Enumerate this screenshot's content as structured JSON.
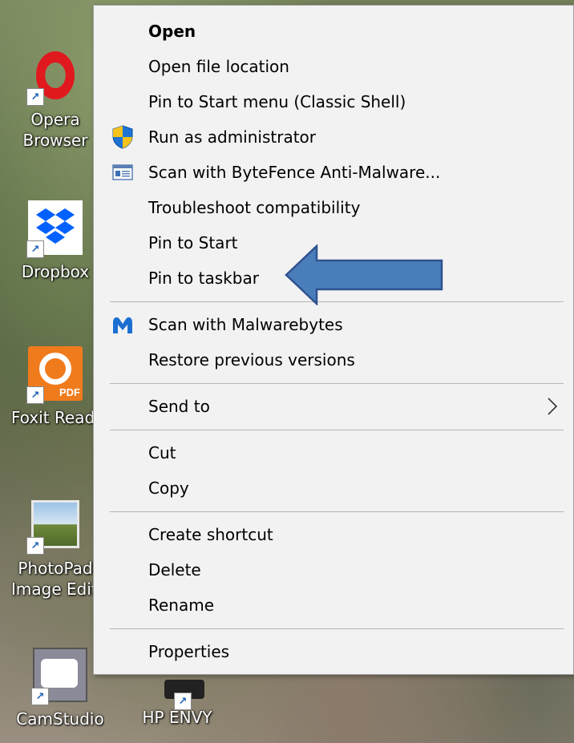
{
  "desktop": {
    "icons": [
      {
        "label_1": "Opera",
        "label_2": "Browser"
      },
      {
        "label_1": "Dropbox"
      },
      {
        "label_1": "Foxit Reader",
        "badge": "PDF"
      },
      {
        "label_1": "PhotoPad",
        "label_2": "Image Editor"
      },
      {
        "label_1": "CamStudio"
      },
      {
        "label_1": "HP ENVY"
      }
    ]
  },
  "context_menu": {
    "groups": [
      [
        {
          "label": "Open",
          "bold": true,
          "icon": null
        },
        {
          "label": "Open file location",
          "icon": null
        },
        {
          "label": "Pin to Start menu (Classic Shell)",
          "icon": null
        },
        {
          "label": "Run as administrator",
          "icon": "uac-shield-icon"
        },
        {
          "label": "Scan with ByteFence Anti-Malware...",
          "icon": "bytefence-icon"
        },
        {
          "label": "Troubleshoot compatibility",
          "icon": null
        },
        {
          "label": "Pin to Start",
          "icon": null
        },
        {
          "label": "Pin to taskbar",
          "icon": null
        }
      ],
      [
        {
          "label": "Scan with Malwarebytes",
          "icon": "malwarebytes-icon"
        },
        {
          "label": "Restore previous versions",
          "icon": null
        }
      ],
      [
        {
          "label": "Send to",
          "icon": null,
          "submenu": true
        }
      ],
      [
        {
          "label": "Cut",
          "icon": null
        },
        {
          "label": "Copy",
          "icon": null
        }
      ],
      [
        {
          "label": "Create shortcut",
          "icon": null
        },
        {
          "label": "Delete",
          "icon": null
        },
        {
          "label": "Rename",
          "icon": null
        }
      ],
      [
        {
          "label": "Properties",
          "icon": null
        }
      ]
    ]
  },
  "annotation": {
    "icon": "callout-arrow-icon",
    "points_to": "Pin to taskbar",
    "color": "#4a7ebb"
  },
  "colors": {
    "menu_bg": "#f2f2f2",
    "separator": "#b5b5b5",
    "arrow_fill": "#4a7ebb",
    "arrow_stroke": "#2f528f"
  }
}
